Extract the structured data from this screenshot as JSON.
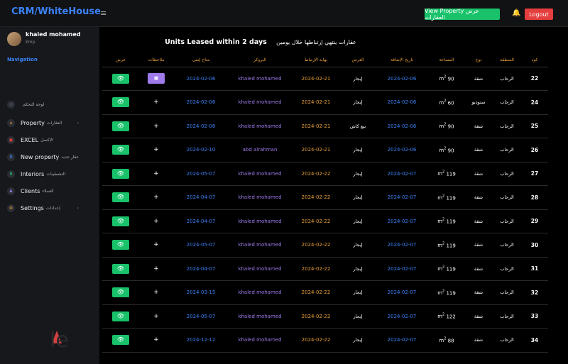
{
  "topbar": {
    "brand": "CRM/WhiteHouse",
    "menu_icon": "≡",
    "view_property": "View Property عرض العقارات",
    "logout": "Logout"
  },
  "sidebar": {
    "user_name": "khaled mohamed",
    "user_role": "Emp",
    "nav_heading": "Navigation",
    "items": [
      {
        "en": "",
        "ar": "لوحة التحكم",
        "icon": "◎",
        "color": "#6b7280"
      },
      {
        "en": "Property",
        "ar": "العقارات",
        "icon": "⌂",
        "color": "#e8a03a",
        "chevron": "‹"
      },
      {
        "en": "EXCEL",
        "ar": "الإكسل",
        "icon": "▣",
        "color": "#e53e3e"
      },
      {
        "en": "New property",
        "ar": "عقار جديد",
        "icon": "B",
        "color": "#3b82f6"
      },
      {
        "en": "Interiors",
        "ar": "التشطيبات",
        "icon": "B",
        "color": "#19c26a"
      },
      {
        "en": "Clients",
        "ar": "العملاء",
        "icon": "♟",
        "color": "#9f7aea"
      },
      {
        "en": "Settings",
        "ar": "إعدادات",
        "icon": "⚙",
        "color": "#e8a03a",
        "chevron": "‹"
      }
    ]
  },
  "title": {
    "en": "Units Leased within 2 days",
    "ar": "عقارات ينتهي إرتباطها خلال يومين"
  },
  "table": {
    "headers": [
      "كود",
      "المنطقة",
      "نوع",
      "المساحة",
      "تاريخ الإضافة",
      "العرض",
      "نهاية الإرتباط",
      "البروكر",
      "متاح إمتى",
      "ملاحظات",
      "عرض"
    ],
    "rows": [
      {
        "id": "22",
        "area": "الرحاب",
        "type": "شقة",
        "space": "90",
        "added": "2024-02-06",
        "offer": "إيجار",
        "end": "2024-02-21",
        "broker": "khaled mohamed",
        "available": "2024-02-06",
        "note": "box"
      },
      {
        "id": "24",
        "area": "الرحاب",
        "type": "ستوديو",
        "space": "60",
        "added": "2024-02-06",
        "offer": "إيجار",
        "end": "2024-02-21",
        "broker": "khaled mohamed",
        "available": "2024-02-06",
        "note": "+"
      },
      {
        "id": "25",
        "area": "الرحاب",
        "type": "شقة",
        "space": "90",
        "added": "2024-02-06",
        "offer": "بيع كاش",
        "end": "2024-02-21",
        "broker": "khaled mohamed",
        "available": "2024-02-06",
        "note": "+"
      },
      {
        "id": "26",
        "area": "الرحاب",
        "type": "شقة",
        "space": "90",
        "added": "2024-02-06",
        "offer": "إيجار",
        "end": "2024-02-21",
        "broker": "abd alrahman",
        "available": "2024-02-10",
        "note": "+"
      },
      {
        "id": "27",
        "area": "الرحاب",
        "type": "شقة",
        "space": "119",
        "added": "2024-02-07",
        "offer": "إيجار",
        "end": "2024-02-22",
        "broker": "khaled mohamed",
        "available": "2024-05-07",
        "note": "+"
      },
      {
        "id": "28",
        "area": "الرحاب",
        "type": "شقة",
        "space": "119",
        "added": "2024-02-07",
        "offer": "إيجار",
        "end": "2024-02-22",
        "broker": "khaled mohamed",
        "available": "2024-04-07",
        "note": "+"
      },
      {
        "id": "29",
        "area": "الرحاب",
        "type": "شقة",
        "space": "119",
        "added": "2024-02-07",
        "offer": "إيجار",
        "end": "2024-02-22",
        "broker": "khaled mohamed",
        "available": "2024-04-07",
        "note": "+"
      },
      {
        "id": "30",
        "area": "الرحاب",
        "type": "شقة",
        "space": "119",
        "added": "2024-02-07",
        "offer": "إيجار",
        "end": "2024-02-22",
        "broker": "khaled mohamed",
        "available": "2024-05-07",
        "note": "+"
      },
      {
        "id": "31",
        "area": "الرحاب",
        "type": "شقة",
        "space": "119",
        "added": "2024-02-07",
        "offer": "إيجار",
        "end": "2024-02-22",
        "broker": "khaled mohamed",
        "available": "2024-04-07",
        "note": "+"
      },
      {
        "id": "32",
        "area": "الرحاب",
        "type": "شقة",
        "space": "119",
        "added": "2024-02-07",
        "offer": "إيجار",
        "end": "2024-02-22",
        "broker": "khaled mohamed",
        "available": "2024-03-15",
        "note": "+"
      },
      {
        "id": "33",
        "area": "الرحاب",
        "type": "شقة",
        "space": "122",
        "added": "2024-02-07",
        "offer": "إيجار",
        "end": "2024-02-22",
        "broker": "khaled mohamed",
        "available": "2024-05-07",
        "note": "+"
      },
      {
        "id": "34",
        "area": "الرحاب",
        "type": "شقة",
        "space": "88",
        "added": "2024-02-07",
        "offer": "إيجار",
        "end": "2024-02-22",
        "broker": "khaled mohamed",
        "available": "2024-12-12",
        "note": "+"
      }
    ]
  },
  "watermark": "le"
}
